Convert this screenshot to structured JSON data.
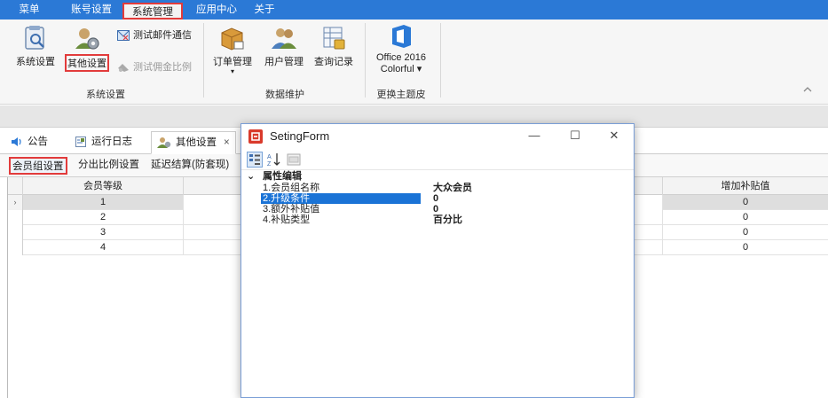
{
  "menubar": {
    "items": [
      {
        "label": "菜单"
      },
      {
        "label": "账号设置"
      },
      {
        "label": "系统管理",
        "active": true
      },
      {
        "label": "应用中心"
      },
      {
        "label": "关于"
      }
    ]
  },
  "ribbon": {
    "groups": {
      "system_settings": {
        "label": "系统设置",
        "buttons": [
          {
            "label": "系统设置",
            "icon": "system-settings-icon"
          },
          {
            "label": "其他设置",
            "icon": "other-settings-icon",
            "highlighted": true
          }
        ],
        "small_buttons": [
          {
            "label": "测试邮件通信",
            "icon": "email-test-icon",
            "enabled": true
          },
          {
            "label": "测试佣金比例",
            "icon": "commission-test-icon",
            "enabled": false
          }
        ]
      },
      "data_maintenance": {
        "label": "数据维护",
        "buttons": [
          {
            "label": "订单管理",
            "icon": "order-management-icon",
            "dropdown": "▾"
          },
          {
            "label": "用户管理",
            "icon": "user-management-icon"
          },
          {
            "label": "查询记录",
            "icon": "query-records-icon"
          }
        ]
      },
      "theme": {
        "label": "更换主题皮",
        "button": {
          "line1": "Office 2016",
          "line2": "Colorful ▾",
          "icon": "office-theme-icon"
        }
      }
    },
    "collapse_icon": "chevron-up-icon"
  },
  "doc_tabs": [
    {
      "label": "公告",
      "icon": "speaker-icon"
    },
    {
      "label": "运行日志",
      "icon": "log-icon"
    },
    {
      "label": "其他设置",
      "icon": "other-settings-icon",
      "active": true,
      "close": "×"
    }
  ],
  "sub_tabs": [
    {
      "label": "会员组设置",
      "active": true
    },
    {
      "label": "分出比例设置"
    },
    {
      "label": "延迟结算(防套现)"
    }
  ],
  "grid": {
    "columns": {
      "level": "会员等级",
      "bonus": "增加补贴值"
    },
    "rows": [
      {
        "level": "1",
        "bonus": "0",
        "selected": true
      },
      {
        "level": "2",
        "bonus": "0"
      },
      {
        "level": "3",
        "bonus": "0"
      },
      {
        "level": "4",
        "bonus": "0"
      }
    ],
    "row_marker": "›"
  },
  "dialog": {
    "title": "SetingForm",
    "title_icon": "app-logo-icon",
    "controls": {
      "minimize": "—",
      "maximize": "☐",
      "close": "✕"
    },
    "category_chevron": "⌄",
    "category": "属性编辑",
    "properties": [
      {
        "name": "1.会员组名称",
        "value": "大众会员"
      },
      {
        "name": "2.升级条件",
        "value": "0",
        "selected": true
      },
      {
        "name": "3.额外补贴值",
        "value": "0"
      },
      {
        "name": "4.补贴类型",
        "value": "百分比"
      }
    ]
  },
  "colors": {
    "menubar": "#2b79d6",
    "highlight": "#e23b3b",
    "selection": "#1a73d6"
  }
}
